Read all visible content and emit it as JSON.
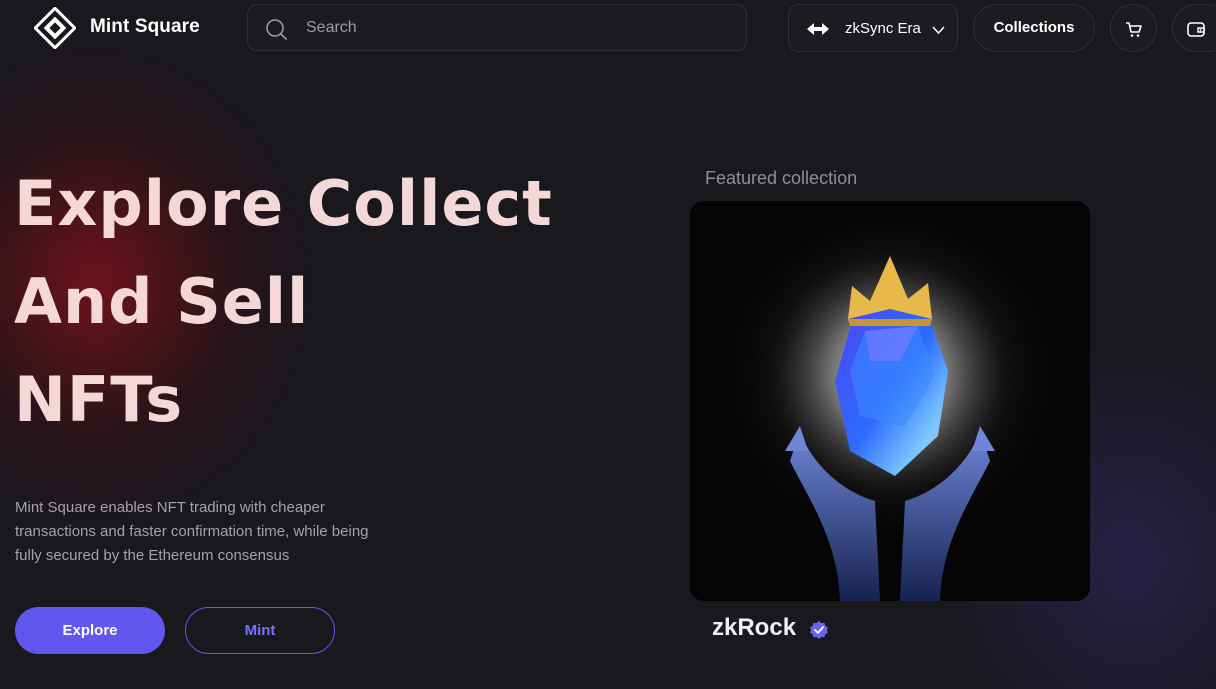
{
  "header": {
    "brand": "Mint Square",
    "search": {
      "placeholder": "Search",
      "value": ""
    },
    "network": {
      "label": "zkSync Era"
    },
    "collections_label": "Collections"
  },
  "hero": {
    "title_lines": [
      "Explore Collect",
      "And Sell",
      "NFTs"
    ],
    "description": "Mint Square enables NFT trading with cheaper transactions and faster confirmation time, while being fully secured by the Ethereum consensus",
    "explore_label": "Explore",
    "mint_label": "Mint"
  },
  "featured": {
    "label": "Featured collection",
    "name": "zkRock",
    "verified": true
  },
  "colors": {
    "background": "#18181d",
    "accent": "#6156ee",
    "hero_text": "#f4d8d7",
    "glow": "#7d121a"
  },
  "icons": {
    "logo": "mint-square-logo",
    "search": "search-icon",
    "network": "zksync-arrows-icon",
    "dropdown": "chevron-down-icon",
    "cart": "cart-icon",
    "wallet": "wallet-icon",
    "verified": "verified-badge-icon"
  }
}
